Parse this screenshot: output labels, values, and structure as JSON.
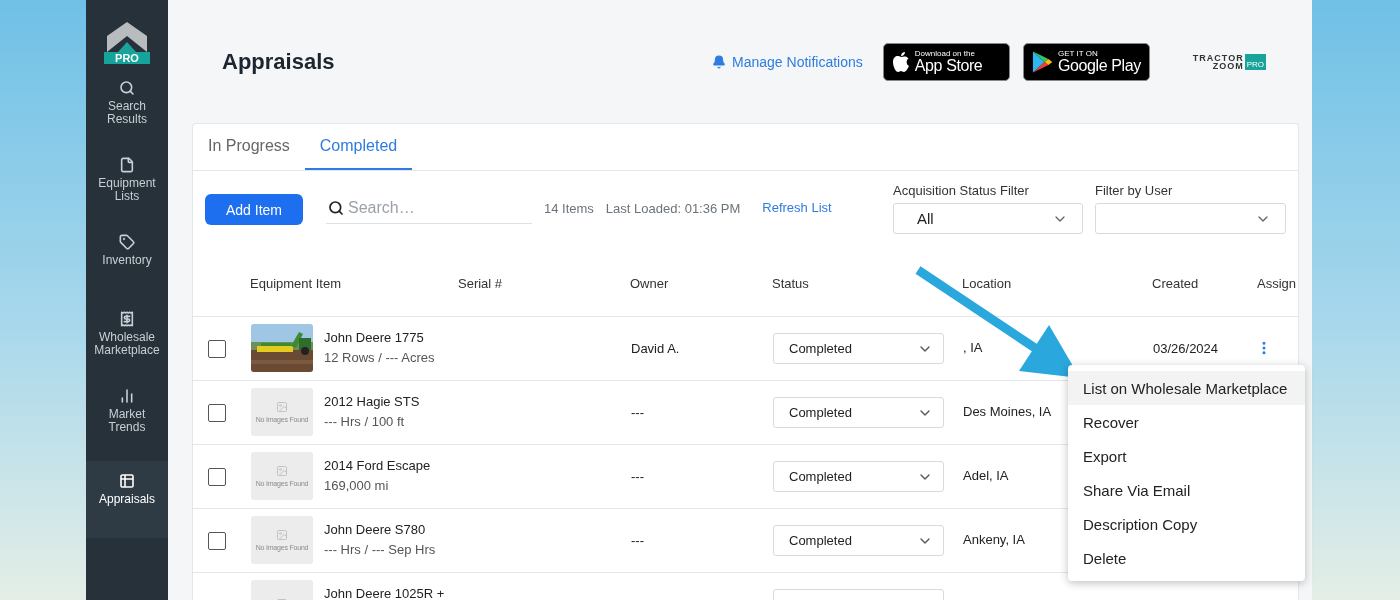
{
  "sidebar": {
    "logo": {
      "badge": "PRO"
    },
    "items": [
      {
        "label": "Search Results",
        "selected": false
      },
      {
        "label": "Equipment Lists",
        "selected": false
      },
      {
        "label": "Inventory",
        "selected": false
      },
      {
        "label": "Wholesale Marketplace",
        "selected": false
      },
      {
        "label": "Market Trends",
        "selected": false
      },
      {
        "label": "Appraisals",
        "selected": true
      }
    ]
  },
  "header": {
    "title": "Appraisals",
    "notifications_link": "Manage Notifications",
    "app_store": {
      "small": "Download on the",
      "big": "App Store"
    },
    "google_play": {
      "small": "GET IT ON",
      "big": "Google Play"
    },
    "brand_logo": {
      "line1": "TRACTOR",
      "line2": "ZOOM",
      "badge": "PRO"
    }
  },
  "tabs": [
    {
      "label": "In Progress",
      "selected": false
    },
    {
      "label": "Completed",
      "selected": true
    }
  ],
  "toolbar": {
    "add_button": "Add Item",
    "search": {
      "placeholder": "Search…"
    },
    "item_count": "14 Items",
    "last_loaded": "Last Loaded: 01:36 PM",
    "refresh_link": "Refresh List",
    "filters": [
      {
        "label": "Acquisition Status Filter",
        "value": "All"
      },
      {
        "label": "Filter by User"
      }
    ]
  },
  "table": {
    "columns": [
      "Equipment Item",
      "Serial #",
      "Owner",
      "Status",
      "Location",
      "Created",
      "Assign"
    ],
    "rows": [
      {
        "checked": false,
        "name": "John Deere 1775",
        "detail": "12 Rows / --- Acres",
        "owner": "David A.",
        "status": "Completed",
        "location": ", IA",
        "created": "03/26/2024",
        "menu_button": true
      },
      {
        "checked": false,
        "image": {
          "kind": "empty",
          "text": "No Images Found"
        },
        "name": "2012 Hagie STS",
        "detail": "--- Hrs / 100 ft",
        "owner": "---",
        "status": "Completed",
        "location": "Des Moines, IA"
      },
      {
        "checked": false,
        "image": {
          "kind": "empty",
          "text": "No Images Found"
        },
        "name": "2014 Ford Escape",
        "detail": "169,000 mi",
        "owner": "---",
        "status": "Completed",
        "location": "Adel, IA"
      },
      {
        "checked": false,
        "image": {
          "kind": "empty",
          "text": "No Images Found"
        },
        "name": "John Deere S780",
        "detail": "--- Hrs / --- Sep Hrs",
        "owner": "---",
        "status": "Completed",
        "location": "Ankeny, IA"
      },
      {
        "image": {
          "kind": "empty"
        },
        "name": "John Deere 1025R +"
      }
    ]
  },
  "context_menu": {
    "items": [
      {
        "label": "List on Wholesale Marketplace",
        "highlighted": true
      },
      {
        "label": "Recover",
        "highlighted": false
      },
      {
        "label": "Export",
        "highlighted": false
      },
      {
        "label": "Share Via Email",
        "highlighted": false
      },
      {
        "label": "Description Copy",
        "highlighted": false
      },
      {
        "label": "Delete",
        "highlighted": false
      }
    ]
  },
  "annotation": {
    "kind": "arrow"
  }
}
